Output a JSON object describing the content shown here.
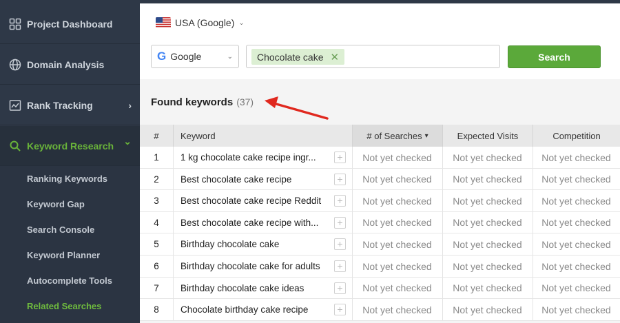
{
  "sidebar": {
    "items": [
      {
        "label": "Project Dashboard",
        "icon": "dashboard-grid-icon"
      },
      {
        "label": "Domain Analysis",
        "icon": "globe-icon"
      },
      {
        "label": "Rank Tracking",
        "icon": "line-chart-icon",
        "chevron": "›"
      },
      {
        "label": "Keyword Research",
        "icon": "search-icon",
        "chevron": "⌄"
      }
    ],
    "sub_items": [
      {
        "label": "Ranking Keywords"
      },
      {
        "label": "Keyword Gap"
      },
      {
        "label": "Search Console"
      },
      {
        "label": "Keyword Planner"
      },
      {
        "label": "Autocomplete Tools"
      },
      {
        "label": "Related Searches"
      }
    ]
  },
  "header": {
    "region": "USA (Google)",
    "engine": "Google",
    "engine_logo": "G",
    "tag": "Chocolate cake",
    "tag_remove": "✕",
    "search_button": "Search"
  },
  "results": {
    "title": "Found keywords",
    "count": "(37)"
  },
  "table": {
    "columns": [
      "#",
      "Keyword",
      "# of Searches",
      "Expected Visits",
      "Competition"
    ],
    "sort_indicator": "▾",
    "rows": [
      {
        "num": "1",
        "keyword": "1 kg chocolate cake recipe ingr...",
        "searches": "Not yet checked",
        "visits": "Not yet checked",
        "competition": "Not yet checked"
      },
      {
        "num": "2",
        "keyword": "Best chocolate cake recipe",
        "searches": "Not yet checked",
        "visits": "Not yet checked",
        "competition": "Not yet checked"
      },
      {
        "num": "3",
        "keyword": "Best chocolate cake recipe Reddit",
        "searches": "Not yet checked",
        "visits": "Not yet checked",
        "competition": "Not yet checked"
      },
      {
        "num": "4",
        "keyword": "Best chocolate cake recipe with...",
        "searches": "Not yet checked",
        "visits": "Not yet checked",
        "competition": "Not yet checked"
      },
      {
        "num": "5",
        "keyword": "Birthday chocolate cake",
        "searches": "Not yet checked",
        "visits": "Not yet checked",
        "competition": "Not yet checked"
      },
      {
        "num": "6",
        "keyword": "Birthday chocolate cake for adults",
        "searches": "Not yet checked",
        "visits": "Not yet checked",
        "competition": "Not yet checked"
      },
      {
        "num": "7",
        "keyword": "Birthday chocolate cake ideas",
        "searches": "Not yet checked",
        "visits": "Not yet checked",
        "competition": "Not yet checked"
      },
      {
        "num": "8",
        "keyword": "Chocolate birthday cake recipe",
        "searches": "Not yet checked",
        "visits": "Not yet checked",
        "competition": "Not yet checked"
      }
    ],
    "add_button": "+"
  },
  "colors": {
    "sidebar_bg": "#2e3847",
    "accent_green": "#5ba93a",
    "annotation_arrow": "#e0281e"
  }
}
